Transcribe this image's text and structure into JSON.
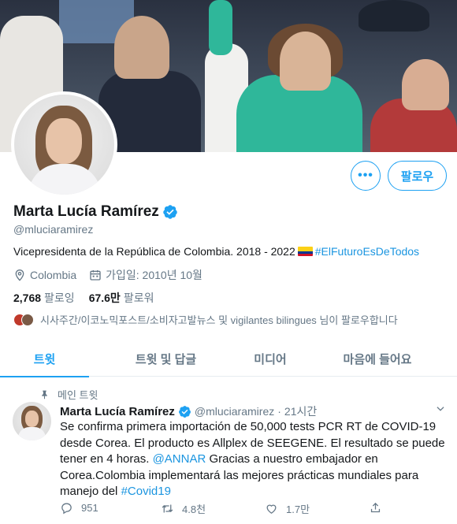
{
  "profile": {
    "name": "Marta Lucía Ramírez",
    "handle": "@mluciaramirez",
    "bio_text": "Vicepresidenta de la República de Colombia. 2018 - 2022",
    "bio_hashtag": "#ElFuturoEsDeTodos",
    "location": "Colombia",
    "joined": "가입일: 2010년 10월",
    "following_count": "2,768",
    "following_label": "팔로잉",
    "followers_count": "67.6만",
    "followers_label": "팔로워",
    "followed_by": "시사주간/이코노믹포스트/소비자고발뉴스 및 vigilantes bilingues 님이 팔로우합니다",
    "more_button": "•••",
    "follow_button": "팔로우"
  },
  "tabs": [
    {
      "label": "트윗",
      "active": true
    },
    {
      "label": "트윗 및 답글",
      "active": false
    },
    {
      "label": "미디어",
      "active": false
    },
    {
      "label": "마음에 들어요",
      "active": false
    }
  ],
  "tweet": {
    "pinned_label": "메인 트윗",
    "name": "Marta Lucía Ramírez",
    "handle": "@mluciaramirez",
    "separator": "·",
    "time": "21시간",
    "text_part1": "Se confirma primera importación de 50,000 tests PCR RT de COVID-19 desde Corea. El producto es Allplex de SEEGENE. El resultado se puede tener en 4 horas. ",
    "mention": "@ANNAR",
    "text_part2": " Gracias a nuestro embajador en Corea.Colombia implementará las mejores prácticas mundiales para manejo del ",
    "hashtag": "#Covid19",
    "replies": "951",
    "retweets": "4.8천",
    "likes": "1.7만"
  },
  "colors": {
    "accent": "#1da1f2",
    "link": "#1b95e0",
    "text": "#14171a",
    "muted": "#657786",
    "border": "#e6ecf0"
  },
  "icons": [
    "verified-badge-icon",
    "location-pin-icon",
    "calendar-icon",
    "pin-icon",
    "chevron-down-icon",
    "reply-icon",
    "retweet-icon",
    "like-icon",
    "share-icon"
  ]
}
